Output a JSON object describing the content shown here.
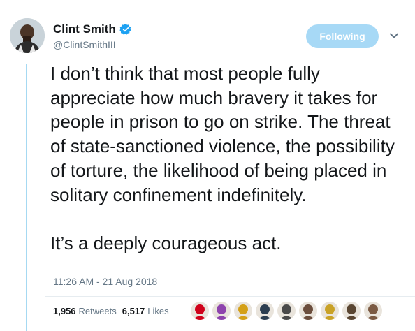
{
  "user": {
    "display_name": "Clint Smith",
    "handle": "@ClintSmithIII",
    "verified": true
  },
  "follow_button": {
    "label": "Following"
  },
  "menu": {
    "icon": "chevron-down-icon"
  },
  "tweet": {
    "text": "I don’t think that most people fully appreciate how much bravery it takes for people in prison to go on strike. The threat of state-sanctioned violence, the possibility of torture, the likelihood of being placed in solitary confinement indefinitely.\n\nIt’s a deeply courageous act.",
    "timestamp": "11:26 AM - 21 Aug 2018"
  },
  "stats": {
    "retweets_count": "1,956",
    "retweets_label": "Retweets",
    "likes_count": "6,517",
    "likes_label": "Likes"
  },
  "colors": {
    "accent": "#1da1f2",
    "follow_button_bg": "#a7d9f6",
    "thread_line": "#a6d9f2",
    "secondary_text": "#657786"
  },
  "likers": [
    {
      "color": "#d0021b"
    },
    {
      "color": "#8e44ad"
    },
    {
      "color": "#d4a017"
    },
    {
      "color": "#2c3e50"
    },
    {
      "color": "#4a4a4a"
    },
    {
      "color": "#6b4e3d"
    },
    {
      "color": "#c9a227"
    },
    {
      "color": "#5a4632"
    },
    {
      "color": "#7b5a43"
    }
  ]
}
